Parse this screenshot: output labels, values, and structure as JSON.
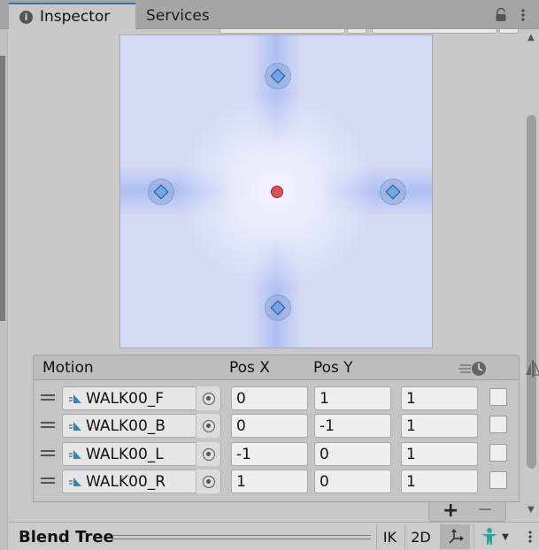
{
  "tabs": [
    {
      "label": "Inspector",
      "active": true
    },
    {
      "label": "Services",
      "active": false
    }
  ],
  "motion_list": {
    "headers": {
      "motion": "Motion",
      "pos_x": "Pos X",
      "pos_y": "Pos Y"
    },
    "rows": [
      {
        "clip": "WALK00_F",
        "pos_x": "0",
        "pos_y": "1",
        "speed": "1",
        "mirror": false
      },
      {
        "clip": "WALK00_B",
        "pos_x": "0",
        "pos_y": "-1",
        "speed": "1",
        "mirror": false
      },
      {
        "clip": "WALK00_L",
        "pos_x": "-1",
        "pos_y": "0",
        "speed": "1",
        "mirror": false
      },
      {
        "clip": "WALK00_R",
        "pos_x": "1",
        "pos_y": "0",
        "speed": "1",
        "mirror": false
      }
    ],
    "add_label": "+",
    "remove_label": "−"
  },
  "bottom_bar": {
    "title": "Blend Tree",
    "ik_label": "IK",
    "mode_2d_label": "2D"
  },
  "colors": {
    "accent": "#3a72b0",
    "blend_background": "#d3daf6",
    "node_fill": "#6da8ee",
    "parameter_dot": "#e05252"
  },
  "icons": {
    "info": "info-icon",
    "lock": "lock-icon",
    "menu": "kebab-menu-icon",
    "animation_clip": "animation-clip-icon",
    "object_picker": "object-picker-icon",
    "speed": "speed-icon",
    "mirror": "mirror-icon",
    "axis": "axis-gizmo-icon",
    "avatar": "avatar-icon"
  }
}
